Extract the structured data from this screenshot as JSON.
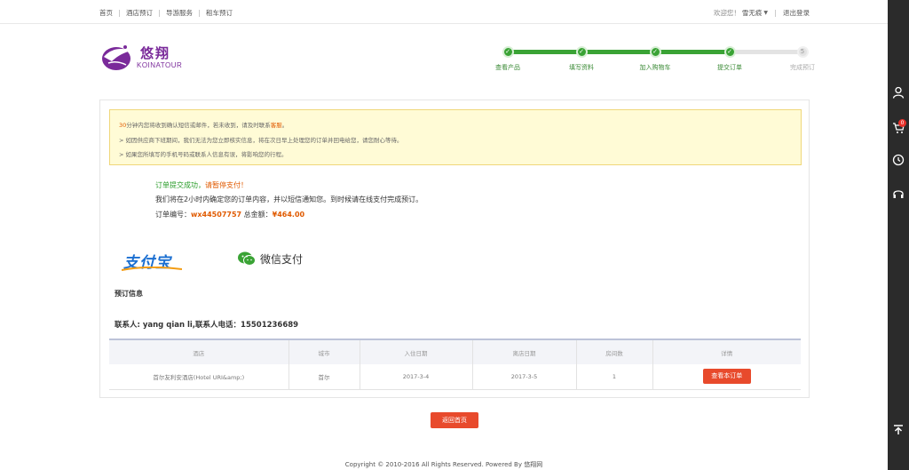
{
  "topbar": {
    "nav": [
      "首页",
      "酒店预订",
      "导游服务",
      "租车预订"
    ],
    "welcome": "欢迎您！",
    "username": "雪无痕",
    "logout": "退出登录"
  },
  "logo": {
    "cn": "悠翔",
    "en": "KOINATOUR",
    "accent": "#7a2a9a"
  },
  "steps": [
    {
      "label": "查看产品",
      "state": "done"
    },
    {
      "label": "填写资料",
      "state": "done"
    },
    {
      "label": "加入购物车",
      "state": "done"
    },
    {
      "label": "提交订单",
      "state": "current"
    },
    {
      "label": "完成预订",
      "state": "pending",
      "number": "5"
    }
  ],
  "notice": {
    "line1_minutes": "30",
    "line1_text": "分钟内您将收到确认短信或邮件，若未收到，请及时联系",
    "line1_link": "客服",
    "line1_end": "。",
    "line2": "> 如因供应商下班期间，我们无法为您立即核实信息，将在次日早上处理您的订单并回电给您，请您耐心等待。",
    "line3": "> 如果您所填写的手机号码或联系人信息有误，将影响您的行程。"
  },
  "result": {
    "success": "订单提交成功，",
    "pay_prompt": "请暂停支付！",
    "confirm_msg": "我们将在2小时内确定您的订单内容，并以短信通知您。到时候请在线支付完成预订。",
    "order_label": "订单编号：",
    "order_no": "wx44507757",
    "total_label": " 总金额：",
    "total": "¥464.00"
  },
  "payment": {
    "alipay": "支付宝",
    "wechat": "微信支付",
    "alipay_color": "#1b6fd1",
    "wechat_color": "#3aa335"
  },
  "booking": {
    "title": "预订信息",
    "contact": "联系人: yang qian li,联系人电话：15501236689",
    "columns": [
      "酒店",
      "城市",
      "入住日期",
      "离店日期",
      "房间数",
      "详情"
    ],
    "rows": [
      {
        "hotel": "首尔友利安酒店(Hotel URI&amp;)",
        "city": "首尔",
        "checkin": "2017-3-4",
        "checkout": "2017-3-5",
        "rooms": "1",
        "action": "查看本订单"
      }
    ]
  },
  "back_button": "返回首页",
  "footer": "Copyright © 2010-2016 All Rights Reserved. Powered By 悠翔网",
  "sidebar": {
    "icons": [
      "user-icon",
      "cart-icon",
      "history-icon",
      "headset-icon",
      "back-to-top-icon"
    ],
    "cart_count": "0"
  }
}
